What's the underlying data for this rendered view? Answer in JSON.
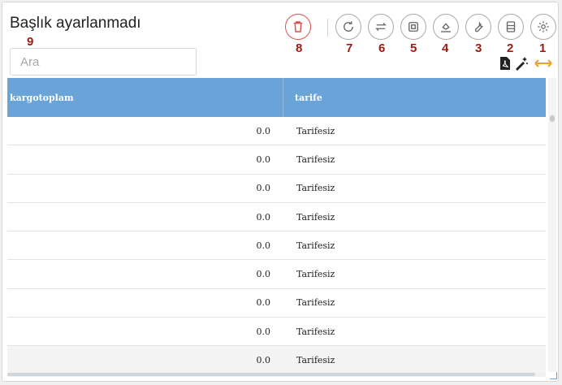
{
  "header": {
    "title": "Başlık ayarlanmadı"
  },
  "search": {
    "placeholder": "Ara"
  },
  "markers": {
    "m1": "1",
    "m2": "2",
    "m3": "3",
    "m4": "4",
    "m5": "5",
    "m6": "6",
    "m7": "7",
    "m8": "8",
    "m9": "9"
  },
  "toolbar": {
    "icons": [
      "trash-icon",
      "refresh-icon",
      "swap-arrows-icon",
      "export-icon",
      "fill-color-icon",
      "wrench-icon",
      "columns-icon",
      "gear-icon"
    ],
    "extra_icons": [
      "pdf-icon",
      "magic-wand-icon",
      "resize-horizontal-icon"
    ]
  },
  "table": {
    "columns": [
      "kargotoplam",
      "tarife"
    ],
    "rows": [
      [
        "0.0",
        "Tarifesiz"
      ],
      [
        "0.0",
        "Tarifesiz"
      ],
      [
        "0.0",
        "Tarifesiz"
      ],
      [
        "0.0",
        "Tarifesiz"
      ],
      [
        "0.0",
        "Tarifesiz"
      ],
      [
        "0.0",
        "Tarifesiz"
      ],
      [
        "0.0",
        "Tarifesiz"
      ],
      [
        "0.0",
        "Tarifesiz"
      ],
      [
        "0.0",
        "Tarifesiz"
      ]
    ]
  },
  "colors": {
    "header_bg": "#6aa3d8",
    "accent_red": "#d9534f",
    "marker": "#9b1b14",
    "resize": "#f0a030"
  }
}
